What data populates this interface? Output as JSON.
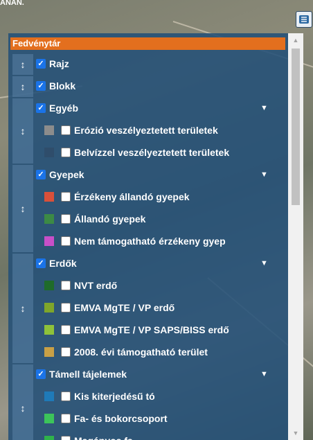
{
  "top_fragment": "ANAN.",
  "layers_button": {
    "icon": "layers-icon"
  },
  "panel": {
    "title": "Fedvénytár",
    "drag_glyph": "↕",
    "check_glyph": "✓",
    "caret_glyph": "▼",
    "scroll_up_glyph": "▲",
    "scroll_down_glyph": "▼",
    "groups": [
      {
        "label": "Rajz",
        "checked": true,
        "expandable": false,
        "items": []
      },
      {
        "label": "Blokk",
        "checked": true,
        "expandable": false,
        "items": []
      },
      {
        "label": "Egyéb",
        "checked": true,
        "expandable": true,
        "items": [
          {
            "label": "Erózió veszélyeztetett területek",
            "checked": false,
            "swatch": "#8c8c8c"
          },
          {
            "label": "Belvízzel veszélyeztetett területek",
            "checked": false,
            "swatch": "#2f4d6b"
          }
        ]
      },
      {
        "label": "Gyepek",
        "checked": true,
        "expandable": true,
        "items": [
          {
            "label": "Érzékeny állandó gyepek",
            "checked": false,
            "swatch": "#d9503a"
          },
          {
            "label": "Állandó gyepek",
            "checked": false,
            "swatch": "#3c8a45"
          },
          {
            "label": "Nem támogatható érzékeny gyep",
            "checked": false,
            "swatch": "#c84fc8"
          }
        ]
      },
      {
        "label": "Erdők",
        "checked": true,
        "expandable": true,
        "items": [
          {
            "label": "NVT erdő",
            "checked": false,
            "swatch": "#1f6b2a"
          },
          {
            "label": "EMVA MgTE / VP erdő",
            "checked": false,
            "swatch": "#7fa62a"
          },
          {
            "label": "EMVA MgTE / VP SAPS/BISS erdő",
            "checked": false,
            "swatch": "#8ec23a"
          },
          {
            "label": "2008. évi támogatható terület",
            "checked": false,
            "swatch": "#c8a046"
          }
        ]
      },
      {
        "label": "Támell tájelemek",
        "checked": true,
        "expandable": true,
        "items": [
          {
            "label": "Kis kiterjedésű tó",
            "checked": false,
            "swatch": "#1f7ab8"
          },
          {
            "label": "Fa- és bokorcsoport",
            "checked": false,
            "swatch": "#3cc45a"
          },
          {
            "label": "Magányos fa",
            "checked": false,
            "swatch": "#2fb34a"
          }
        ]
      }
    ]
  }
}
